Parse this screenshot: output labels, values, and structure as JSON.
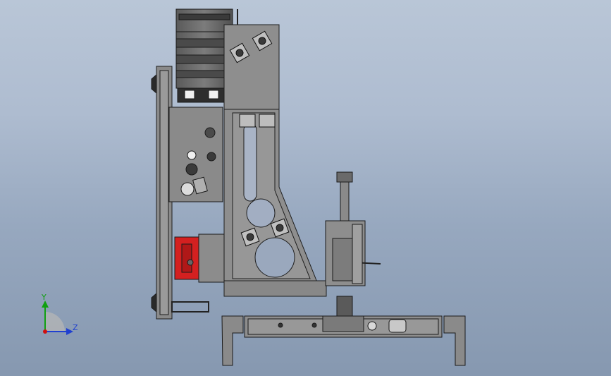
{
  "triad": {
    "y_label": "Y",
    "z_label": "Z",
    "y_color": "#10a010",
    "z_color": "#2040d0",
    "x_color": "#d01010"
  },
  "colors": {
    "background_top": "#b9c6d7",
    "background_bottom": "#8698b0",
    "part_face": "#8e8e8e",
    "part_edge": "#1e1e1e",
    "accent_block": "#d42020"
  }
}
